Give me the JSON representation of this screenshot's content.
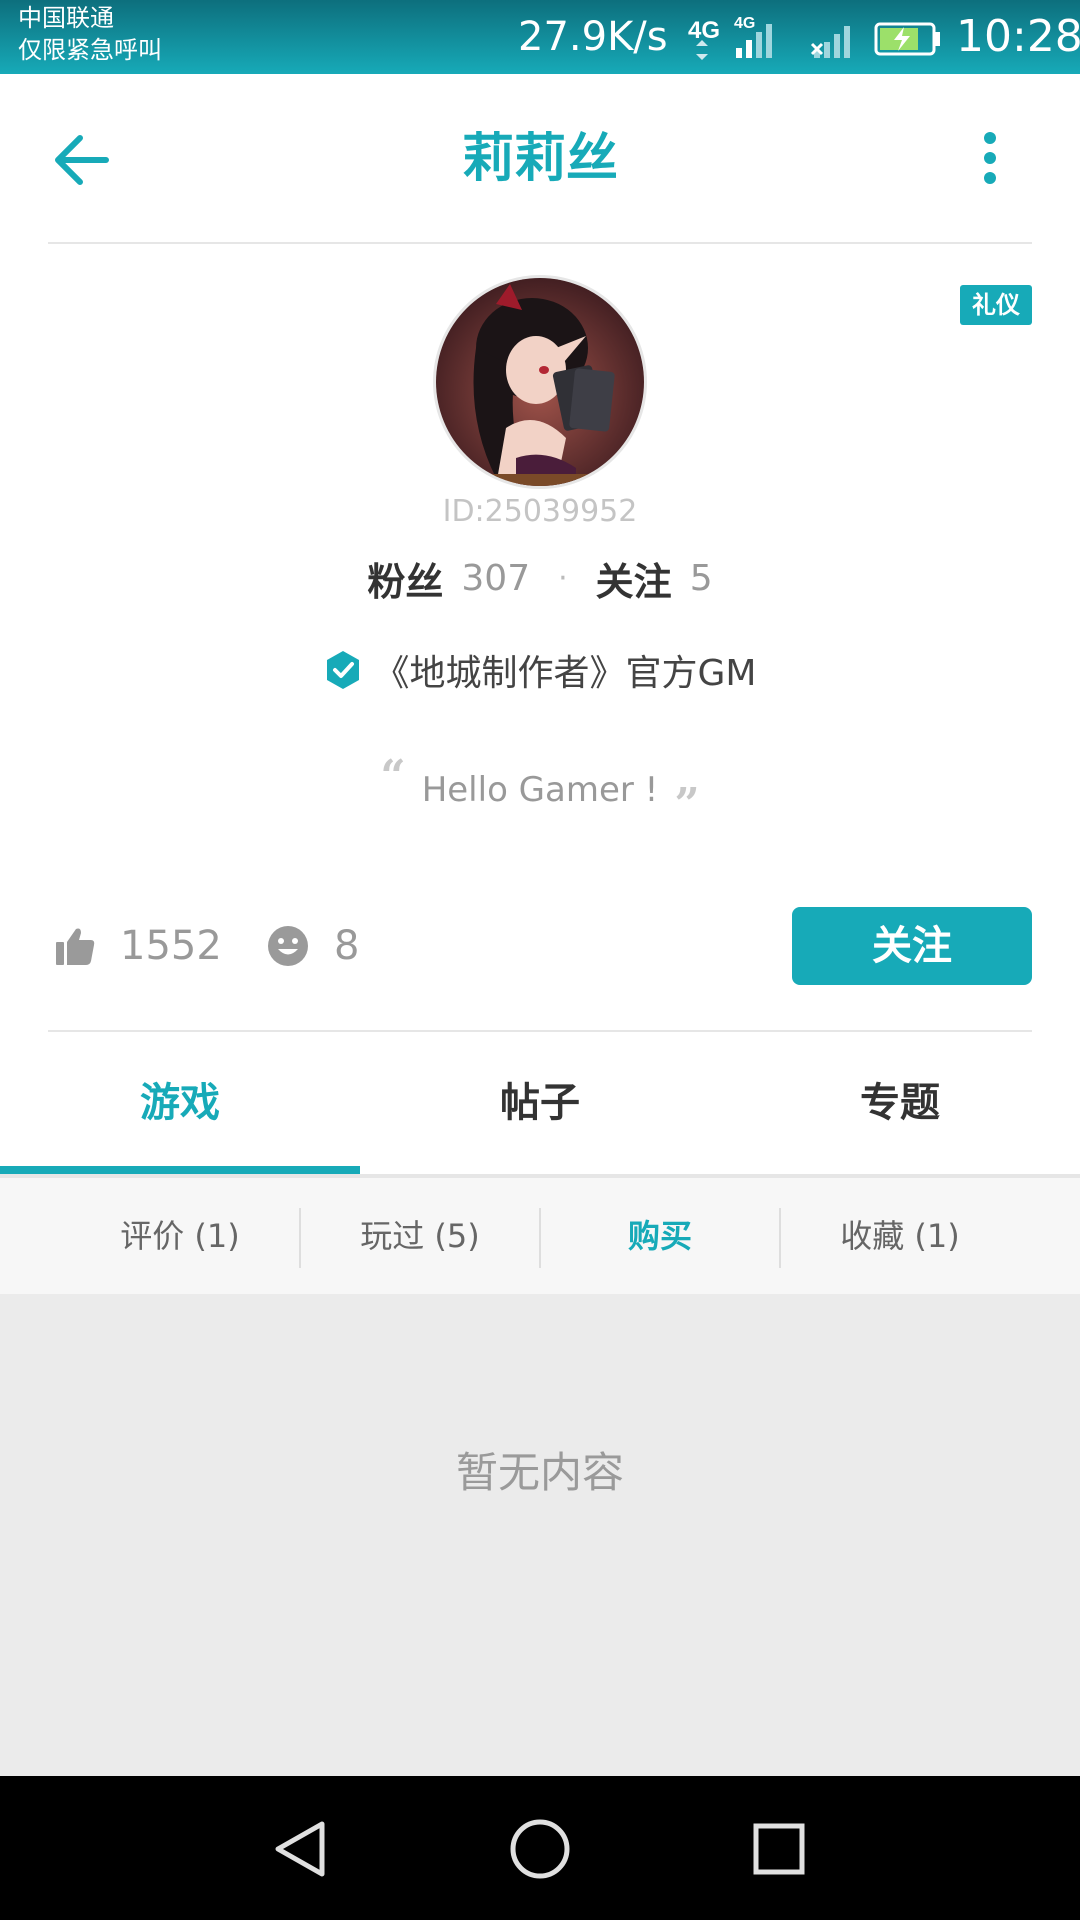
{
  "status_bar": {
    "carrier_line1": "中国联通",
    "carrier_line2": "仅限紧急呼叫",
    "net_speed": "27.9K/s",
    "network_labels": [
      "4G",
      "4G"
    ],
    "time": "10:28",
    "icons": [
      "data-arrows-icon",
      "signal-icon",
      "signal-no-sim-icon",
      "battery-charging-icon"
    ]
  },
  "header": {
    "title": "莉莉丝",
    "back_icon": "arrow-left-icon",
    "more_icon": "more-vertical-icon"
  },
  "profile": {
    "badge": "礼仪",
    "id_text": "ID:25039952",
    "fans_label": "粉丝",
    "fans_count": "307",
    "following_label": "关注",
    "following_count": "5",
    "verified_text": "《地城制作者》官方GM",
    "verified_icon": "verified-check-icon",
    "motto": "Hello Gamer !"
  },
  "actions": {
    "likes_count": "1552",
    "comments_count": "8",
    "follow_label": "关注",
    "like_icon": "thumbs-up-icon",
    "comment_icon": "smiley-icon"
  },
  "tabs": [
    {
      "label": "游戏",
      "active": true
    },
    {
      "label": "帖子",
      "active": false
    },
    {
      "label": "专题",
      "active": false
    }
  ],
  "subtabs": [
    {
      "label": "评价 (1)",
      "active": false
    },
    {
      "label": "玩过 (5)",
      "active": false
    },
    {
      "label": "购买",
      "active": true
    },
    {
      "label": "收藏 (1)",
      "active": false
    }
  ],
  "content": {
    "empty_text": "暂无内容"
  },
  "colors": {
    "accent": "#17aab8",
    "status_bar_dark": "#0d6f7d"
  }
}
